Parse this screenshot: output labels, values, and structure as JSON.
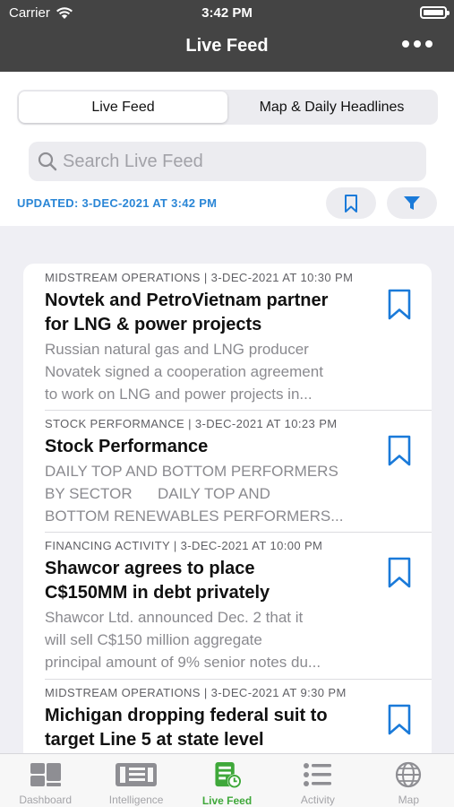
{
  "status_bar": {
    "carrier": "Carrier",
    "time": "3:42 PM"
  },
  "nav": {
    "title": "Live Feed"
  },
  "segments": [
    {
      "label": "Live Feed",
      "active": true
    },
    {
      "label": "Map & Daily Headlines",
      "active": false
    }
  ],
  "search": {
    "placeholder": "Search Live Feed",
    "value": ""
  },
  "updated": "UPDATED: 3-DEC-2021 AT 3:42 PM",
  "colors": {
    "accent_blue": "#1a7ad9",
    "active_green": "#3fa83a",
    "topbar": "#444444"
  },
  "feed": [
    {
      "meta": "MIDSTREAM OPERATIONS  |  3-DEC-2021 AT 10:30 PM",
      "title_lines": [
        "Novtek and PetroVietnam partner",
        "for LNG & power projects"
      ],
      "desc_lines": [
        "Russian natural gas and LNG producer",
        "Novatek signed a cooperation agreement",
        "to work on LNG and power projects in..."
      ]
    },
    {
      "meta": "STOCK PERFORMANCE  |  3-DEC-2021 AT 10:23 PM",
      "title_lines": [
        "Stock Performance"
      ],
      "desc_lines": [
        "DAILY TOP AND BOTTOM PERFORMERS",
        "BY SECTOR      DAILY TOP AND",
        "BOTTOM RENEWABLES PERFORMERS..."
      ]
    },
    {
      "meta": "FINANCING ACTIVITY  |  3-DEC-2021 AT 10:00 PM",
      "title_lines": [
        "Shawcor agrees to place",
        "C$150MM in debt privately"
      ],
      "desc_lines": [
        "Shawcor Ltd. announced Dec. 2 that it",
        "will sell C$150 million aggregate",
        "principal amount of 9% senior notes du..."
      ]
    },
    {
      "meta": "MIDSTREAM OPERATIONS  |  3-DEC-2021 AT 9:30 PM",
      "title_lines": [
        "Michigan dropping federal suit to",
        "target Line 5 at state level"
      ],
      "desc_lines": []
    }
  ],
  "tabbar": [
    {
      "label": "Dashboard",
      "icon": "dashboard-icon",
      "active": false
    },
    {
      "label": "Intelligence",
      "icon": "intelligence-icon",
      "active": false
    },
    {
      "label": "Live Feed",
      "icon": "live-feed-icon",
      "active": true
    },
    {
      "label": "Activity",
      "icon": "activity-icon",
      "active": false
    },
    {
      "label": "Map",
      "icon": "globe-icon",
      "active": false
    }
  ]
}
